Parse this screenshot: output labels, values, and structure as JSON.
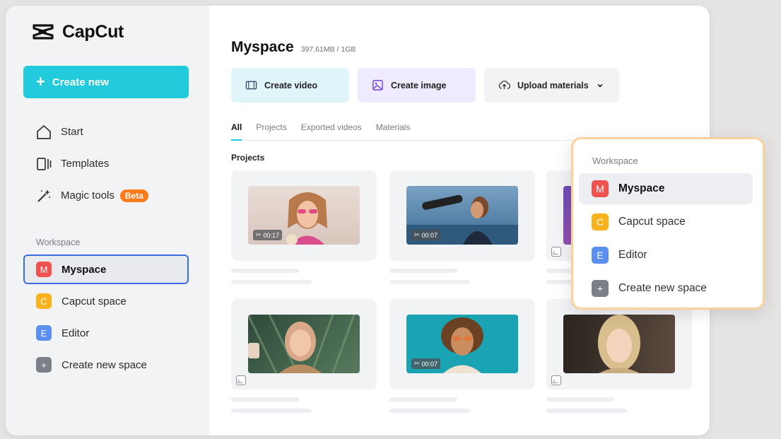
{
  "app": {
    "name": "CapCut"
  },
  "sidebar": {
    "create_new_label": "Create new",
    "nav": [
      {
        "label": "Start",
        "icon": "home-icon"
      },
      {
        "label": "Templates",
        "icon": "templates-icon"
      },
      {
        "label": "Magic tools",
        "icon": "magic-wand-icon",
        "badge": "Beta"
      }
    ],
    "workspace_label": "Workspace",
    "workspaces": [
      {
        "letter": "M",
        "label": "Myspace",
        "color": "#f0524f",
        "active": true
      },
      {
        "letter": "C",
        "label": "Capcut space",
        "color": "#f9b21b",
        "active": false
      },
      {
        "letter": "E",
        "label": "Editor",
        "color": "#5a8ef0",
        "active": false
      },
      {
        "letter": "+",
        "label": "Create new space",
        "color": "#7b7f87",
        "active": false
      }
    ]
  },
  "main": {
    "title": "Myspace",
    "storage": "397.61MB / 1GB",
    "actions": [
      {
        "label": "Create video",
        "icon": "film-icon"
      },
      {
        "label": "Create image",
        "icon": "image-icon"
      },
      {
        "label": "Upload materials",
        "icon": "cloud-upload-icon"
      }
    ],
    "tabs": [
      {
        "label": "All",
        "active": true
      },
      {
        "label": "Projects",
        "active": false
      },
      {
        "label": "Exported videos",
        "active": false
      },
      {
        "label": "Materials",
        "active": false
      }
    ],
    "section_title": "Projects",
    "projects": [
      {
        "duration": "00:17",
        "type": "video"
      },
      {
        "duration": "00:07",
        "type": "video"
      },
      {
        "duration": "",
        "type": "image"
      },
      {
        "duration": "",
        "type": "image"
      },
      {
        "duration": "00:07",
        "type": "video"
      },
      {
        "duration": "",
        "type": "image"
      }
    ]
  },
  "popup": {
    "label": "Workspace",
    "items": [
      {
        "letter": "M",
        "label": "Myspace",
        "color": "#f0524f",
        "active": true
      },
      {
        "letter": "C",
        "label": "Capcut space",
        "color": "#f9b21b",
        "active": false
      },
      {
        "letter": "E",
        "label": "Editor",
        "color": "#5a8ef0",
        "active": false
      },
      {
        "letter": "+",
        "label": "Create new space",
        "color": "#7b7f87",
        "active": false
      }
    ]
  }
}
